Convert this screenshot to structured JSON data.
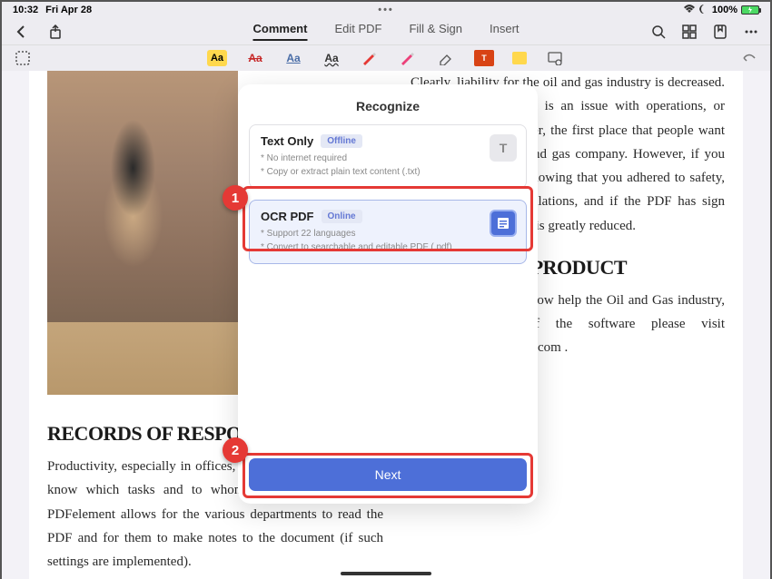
{
  "status": {
    "time": "10:32",
    "date": "Fri Apr 28",
    "center": "•••",
    "battery_pct": "100%",
    "wifi_icon": "wifi",
    "moon_icon": "moon"
  },
  "nav": {
    "tabs": [
      "Comment",
      "Edit PDF",
      "Fill & Sign",
      "Insert"
    ],
    "active_tab": 0
  },
  "toolbar": {
    "highlight_label": "Aa",
    "aa_strike": "Aa",
    "aa_underline": "Aa",
    "aa_plain": "Aa",
    "textbox_label": "T",
    "text_icon_label": "T"
  },
  "document": {
    "left_heading": "RECORDS OF RESPONSIBILITY",
    "left_body": "Productivity, especially in offices, demands that each person know which tasks and to whom the task is addressed. PDFelement allows for the various departments to read the PDF and for them to make notes to the document (if such settings are implemented).",
    "right_body_1": "Clearly, liability for the oil and gas industry is decreased. Generally, when there is an issue with operations, or when there is a disaster, the first place that people want to look to is the oil and gas company. However, if you have documentation showing that you adhered to safety, standards, and to regulations, and if the PDF has sign offs and such, liability is greatly reduced.",
    "right_heading": "ABOUT OUR PRODUCT",
    "right_body_2": "To know more about how help the Oil and Gas industry, to try a trial of the software please visit http://pdf.wondershare.com ."
  },
  "overlay": {
    "title": "Recognize",
    "options": [
      {
        "title": "Text Only",
        "badge": "Offline",
        "desc1": "* No internet required",
        "desc2": "* Copy or extract plain text content (.txt)",
        "icon_label": "T"
      },
      {
        "title": "OCR PDF",
        "badge": "Online",
        "desc1": "* Support 22 languages",
        "desc2": "* Convert to searchable and editable PDF (.pdf)",
        "icon_label": ""
      }
    ],
    "next_label": "Next"
  },
  "callouts": {
    "one": "1",
    "two": "2"
  }
}
